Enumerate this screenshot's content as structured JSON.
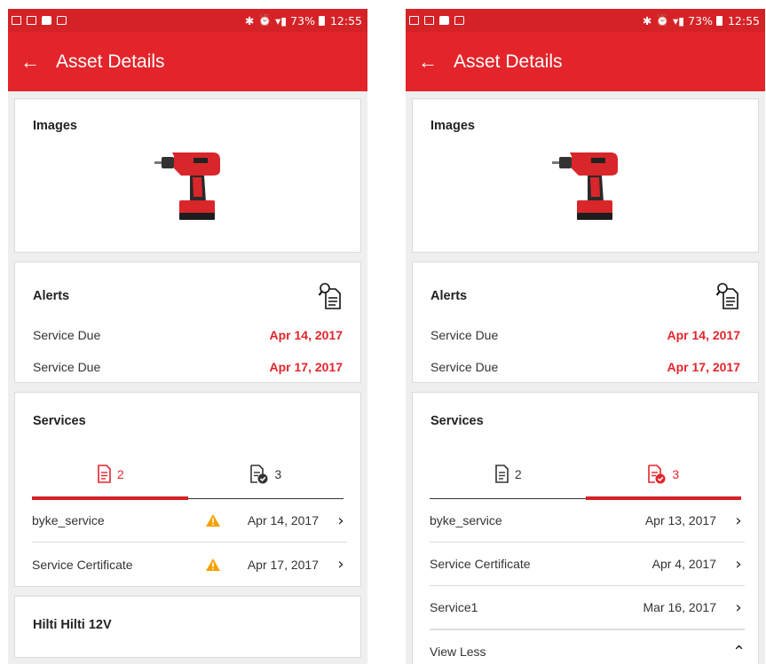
{
  "status_bar": {
    "battery": "73%",
    "time": "12:55"
  },
  "app_bar": {
    "back_icon": "arrow-left-icon",
    "title": "Asset Details"
  },
  "left": {
    "images": {
      "title": "Images"
    },
    "alerts": {
      "title": "Alerts",
      "rows": [
        {
          "label": "Service Due",
          "date": "Apr 14, 2017"
        },
        {
          "label": "Service Due",
          "date": "Apr 17, 2017"
        }
      ]
    },
    "services": {
      "title": "Services",
      "tabs": [
        {
          "count": "2"
        },
        {
          "count": "3"
        }
      ],
      "active_tab": 0,
      "rows": [
        {
          "name": "byke_service",
          "date": "Apr 14, 2017"
        },
        {
          "name": "Service Certificate",
          "date": "Apr 17, 2017"
        }
      ]
    },
    "asset": {
      "title": "Hilti Hilti 12V"
    }
  },
  "right": {
    "images": {
      "title": "Images"
    },
    "alerts": {
      "title": "Alerts",
      "rows": [
        {
          "label": "Service Due",
          "date": "Apr 14, 2017"
        },
        {
          "label": "Service Due",
          "date": "Apr 17, 2017"
        }
      ]
    },
    "services": {
      "title": "Services",
      "tabs": [
        {
          "count": "2"
        },
        {
          "count": "3"
        }
      ],
      "active_tab": 1,
      "rows": [
        {
          "name": "byke_service",
          "date": "Apr 13, 2017"
        },
        {
          "name": "Service Certificate",
          "date": "Apr 4, 2017"
        },
        {
          "name": "Service1",
          "date": "Mar 16, 2017"
        }
      ],
      "view_less": "View Less"
    }
  },
  "colors": {
    "brand_red": "#e3252b",
    "status_red": "#d42226",
    "warning_orange": "#f4a100"
  }
}
